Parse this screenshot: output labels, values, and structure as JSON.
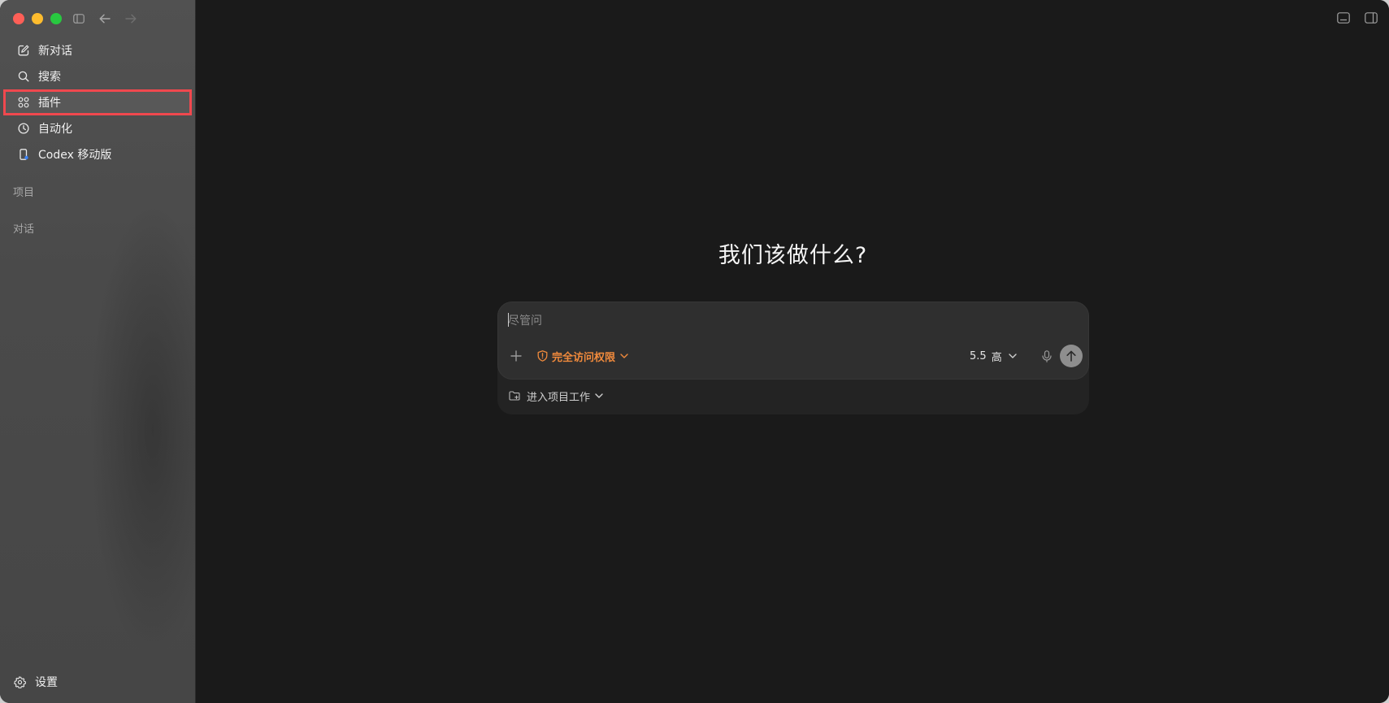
{
  "window": {
    "traffic_lights": {
      "close": "#fe5f57",
      "minimize": "#febc2e",
      "maximize": "#28c840"
    },
    "toolbar_icons": [
      "sidebar-toggle-icon",
      "back-arrow-icon",
      "forward-arrow-icon"
    ],
    "top_right_icons": [
      "terminal-panel-icon",
      "right-panel-icon"
    ]
  },
  "sidebar": {
    "items": [
      {
        "label": "新对话",
        "icon": "compose-icon"
      },
      {
        "label": "搜索",
        "icon": "search-icon"
      },
      {
        "label": "插件",
        "icon": "plugins-grid-icon",
        "highlighted": true
      },
      {
        "label": "自动化",
        "icon": "clock-icon"
      },
      {
        "label": "Codex 移动版",
        "icon": "mobile-icon"
      }
    ],
    "sections": {
      "projects": "项目",
      "conversations": "对话"
    },
    "settings_label": "设置",
    "highlight_color": "#f0484e"
  },
  "main": {
    "headline": "我们该做什么?",
    "composer": {
      "placeholder": "尽管问",
      "permission_label": "完全访问权限",
      "permission_color": "#f08a3c",
      "model_version": "5.5",
      "model_level": "高",
      "project_label": "进入项目工作"
    }
  }
}
